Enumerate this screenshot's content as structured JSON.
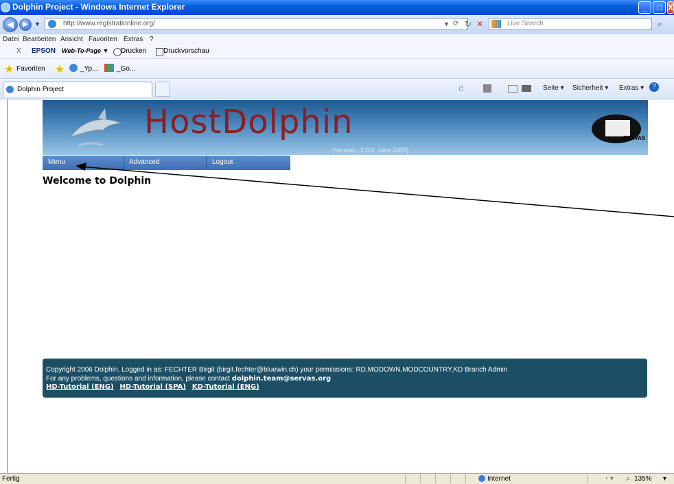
{
  "window": {
    "title": "Dolphin Project - Windows Internet Explorer",
    "min": "_",
    "max": "□",
    "close": "X"
  },
  "address": {
    "url": "http://www.registrationline.org/",
    "search_placeholder": "Live Search"
  },
  "menubar": [
    "Datei",
    "Bearbeiten",
    "Ansicht",
    "Favoriten",
    "Extras",
    "?"
  ],
  "epson": {
    "close": "X",
    "brand": "EPSON",
    "product": "Web-To-Page ▼",
    "print": "Drucken",
    "preview": "Druckvorschau"
  },
  "favorites": {
    "label": "Favoriten",
    "link1": "_Yp...",
    "link2": "_Go..."
  },
  "tab": {
    "title": "Dolphin Project"
  },
  "commandbar": {
    "page": "Seite ▾",
    "security": "Sicherheit ▾",
    "tools": "Extras ▾"
  },
  "site": {
    "logo": "HostDolphin",
    "version": "(Version - 2.0.0, June 2009)",
    "partner": "SERVAS",
    "nav": [
      "Menu",
      "Advanced",
      "Logout"
    ],
    "welcome": "Welcome to Dolphin",
    "footer": {
      "line1": "Copyright 2006 Dolphin. Logged in as: FECHTER Birgit (birgit.fechter@bluewin.ch) your permissions: RD,MODOWN,MODCOUNTRY,KD Branch Admin",
      "line2_prefix": "For any problems, questions and information, please contact ",
      "line2_email": "dolphin.team@servas.org",
      "links": [
        "HD-Tutorial (ENG)",
        "HD-Tutorial (SPA)",
        "KD-Tutorial (ENG)"
      ]
    }
  },
  "status": {
    "left": "Fertig",
    "zone": "Internet",
    "zoom": "135%"
  },
  "colors": {
    "titlebar": "#0a5fe0",
    "banner": "#4a88bd",
    "logo": "#8e1d24",
    "footer": "#1c4f66",
    "nav": "#4f7ec2"
  }
}
